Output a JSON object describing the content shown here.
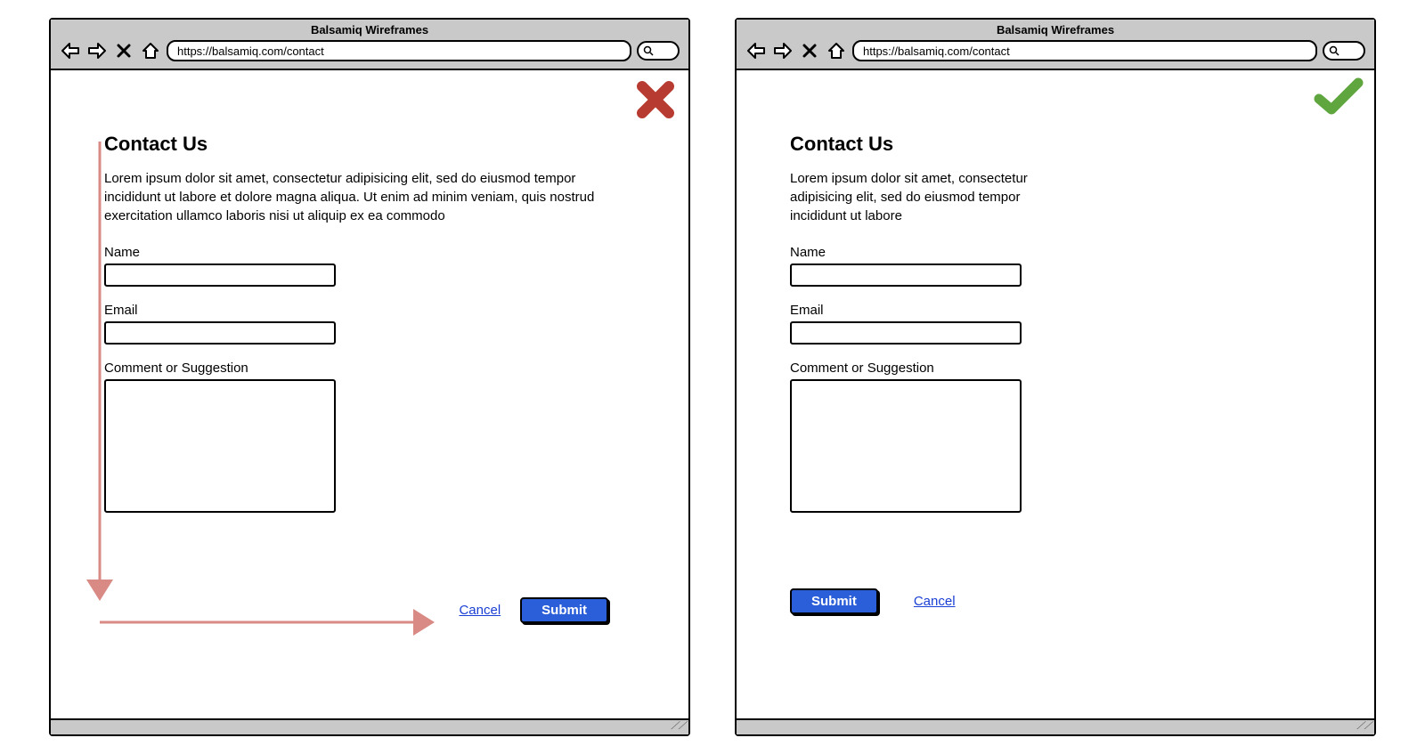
{
  "app": {
    "window_title": "Balsamiq Wireframes",
    "url": "https://balsamiq.com/contact"
  },
  "left": {
    "badge": "wrong",
    "heading": "Contact Us",
    "intro": "Lorem ipsum dolor sit amet, consectetur adipisicing elit, sed do eiusmod tempor incididunt ut labore et dolore magna aliqua. Ut enim ad minim veniam, quis nostrud exercitation ullamco laboris nisi ut aliquip ex ea commodo",
    "labels": {
      "name": "Name",
      "email": "Email",
      "comment": "Comment or Suggestion"
    },
    "actions": {
      "cancel": "Cancel",
      "submit": "Submit"
    }
  },
  "right": {
    "badge": "correct",
    "heading": "Contact Us",
    "intro": "Lorem ipsum dolor sit amet, consectetur adipisicing elit, sed do eiusmod tempor incididunt ut labore",
    "labels": {
      "name": "Name",
      "email": "Email",
      "comment": "Comment or Suggestion"
    },
    "actions": {
      "submit": "Submit",
      "cancel": "Cancel"
    }
  },
  "colors": {
    "wrong": "#b83b32",
    "correct": "#5fa63f",
    "primary": "#2b5fd9",
    "link": "#1a3fd4",
    "annotation": "#d98a84"
  }
}
